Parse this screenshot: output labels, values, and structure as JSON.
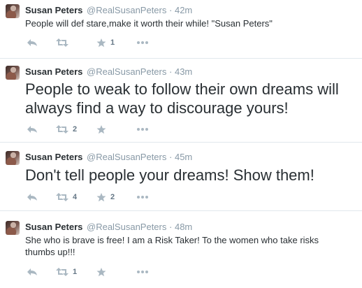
{
  "colors": {
    "icon": "#aab8c2",
    "muted": "#8899a6",
    "text": "#292f33",
    "divider": "#e1e8ed"
  },
  "tweets": [
    {
      "name": "Susan Peters",
      "handle": "@RealSusanPeters",
      "sep": "·",
      "time": "42m",
      "text": "People will def stare,make it worth their while! \"Susan Peters\"",
      "retweets": "",
      "favorites": "1"
    },
    {
      "name": "Susan Peters",
      "handle": "@RealSusanPeters",
      "sep": "·",
      "time": "43m",
      "text": "People to weak to follow their own dreams will always find a way to discourage yours!",
      "retweets": "2",
      "favorites": ""
    },
    {
      "name": "Susan Peters",
      "handle": "@RealSusanPeters",
      "sep": "·",
      "time": "45m",
      "text": "Don't tell people your dreams! Show them!",
      "retweets": "4",
      "favorites": "2"
    },
    {
      "name": "Susan Peters",
      "handle": "@RealSusanPeters",
      "sep": "·",
      "time": "48m",
      "text": "She who is brave is free! I am a Risk Taker! To the women who take risks thumbs up!!!",
      "retweets": "1",
      "favorites": ""
    }
  ]
}
